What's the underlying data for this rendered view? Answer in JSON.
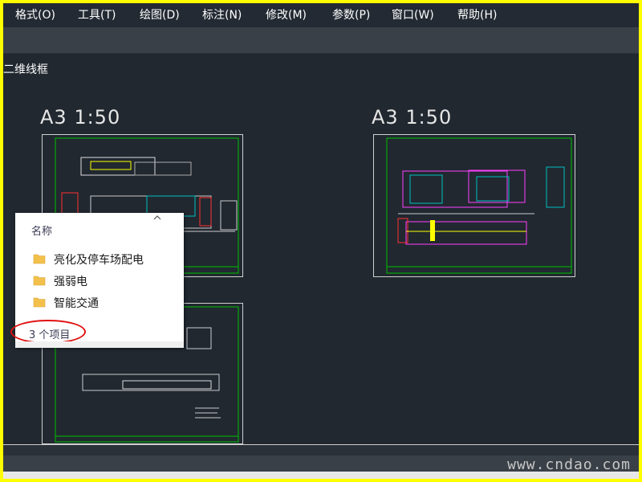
{
  "menu": {
    "items": [
      {
        "label": "格式(O)"
      },
      {
        "label": "工具(T)"
      },
      {
        "label": "绘图(D)"
      },
      {
        "label": "标注(N)"
      },
      {
        "label": "修改(M)"
      },
      {
        "label": "参数(P)"
      },
      {
        "label": "窗口(W)"
      },
      {
        "label": "帮助(H)"
      }
    ]
  },
  "viewport": {
    "label": "二维线框"
  },
  "sheets": [
    {
      "title": "A3 1:50"
    },
    {
      "title": "A3 1:50"
    }
  ],
  "explorer": {
    "column_header": "名称",
    "folders": [
      {
        "name": "亮化及停车场配电",
        "icon": "folder-icon"
      },
      {
        "name": "强弱电",
        "icon": "folder-icon"
      },
      {
        "name": "智能交通",
        "icon": "folder-icon"
      }
    ],
    "item_count": "3 个项目"
  },
  "watermark": "www.cndao.com",
  "colors": {
    "background": "#212830",
    "frame_border": "#ffff00",
    "drawing_green": "#00c000",
    "highlight_red": "#e01010",
    "folder_yellow": "#f3c14b"
  }
}
